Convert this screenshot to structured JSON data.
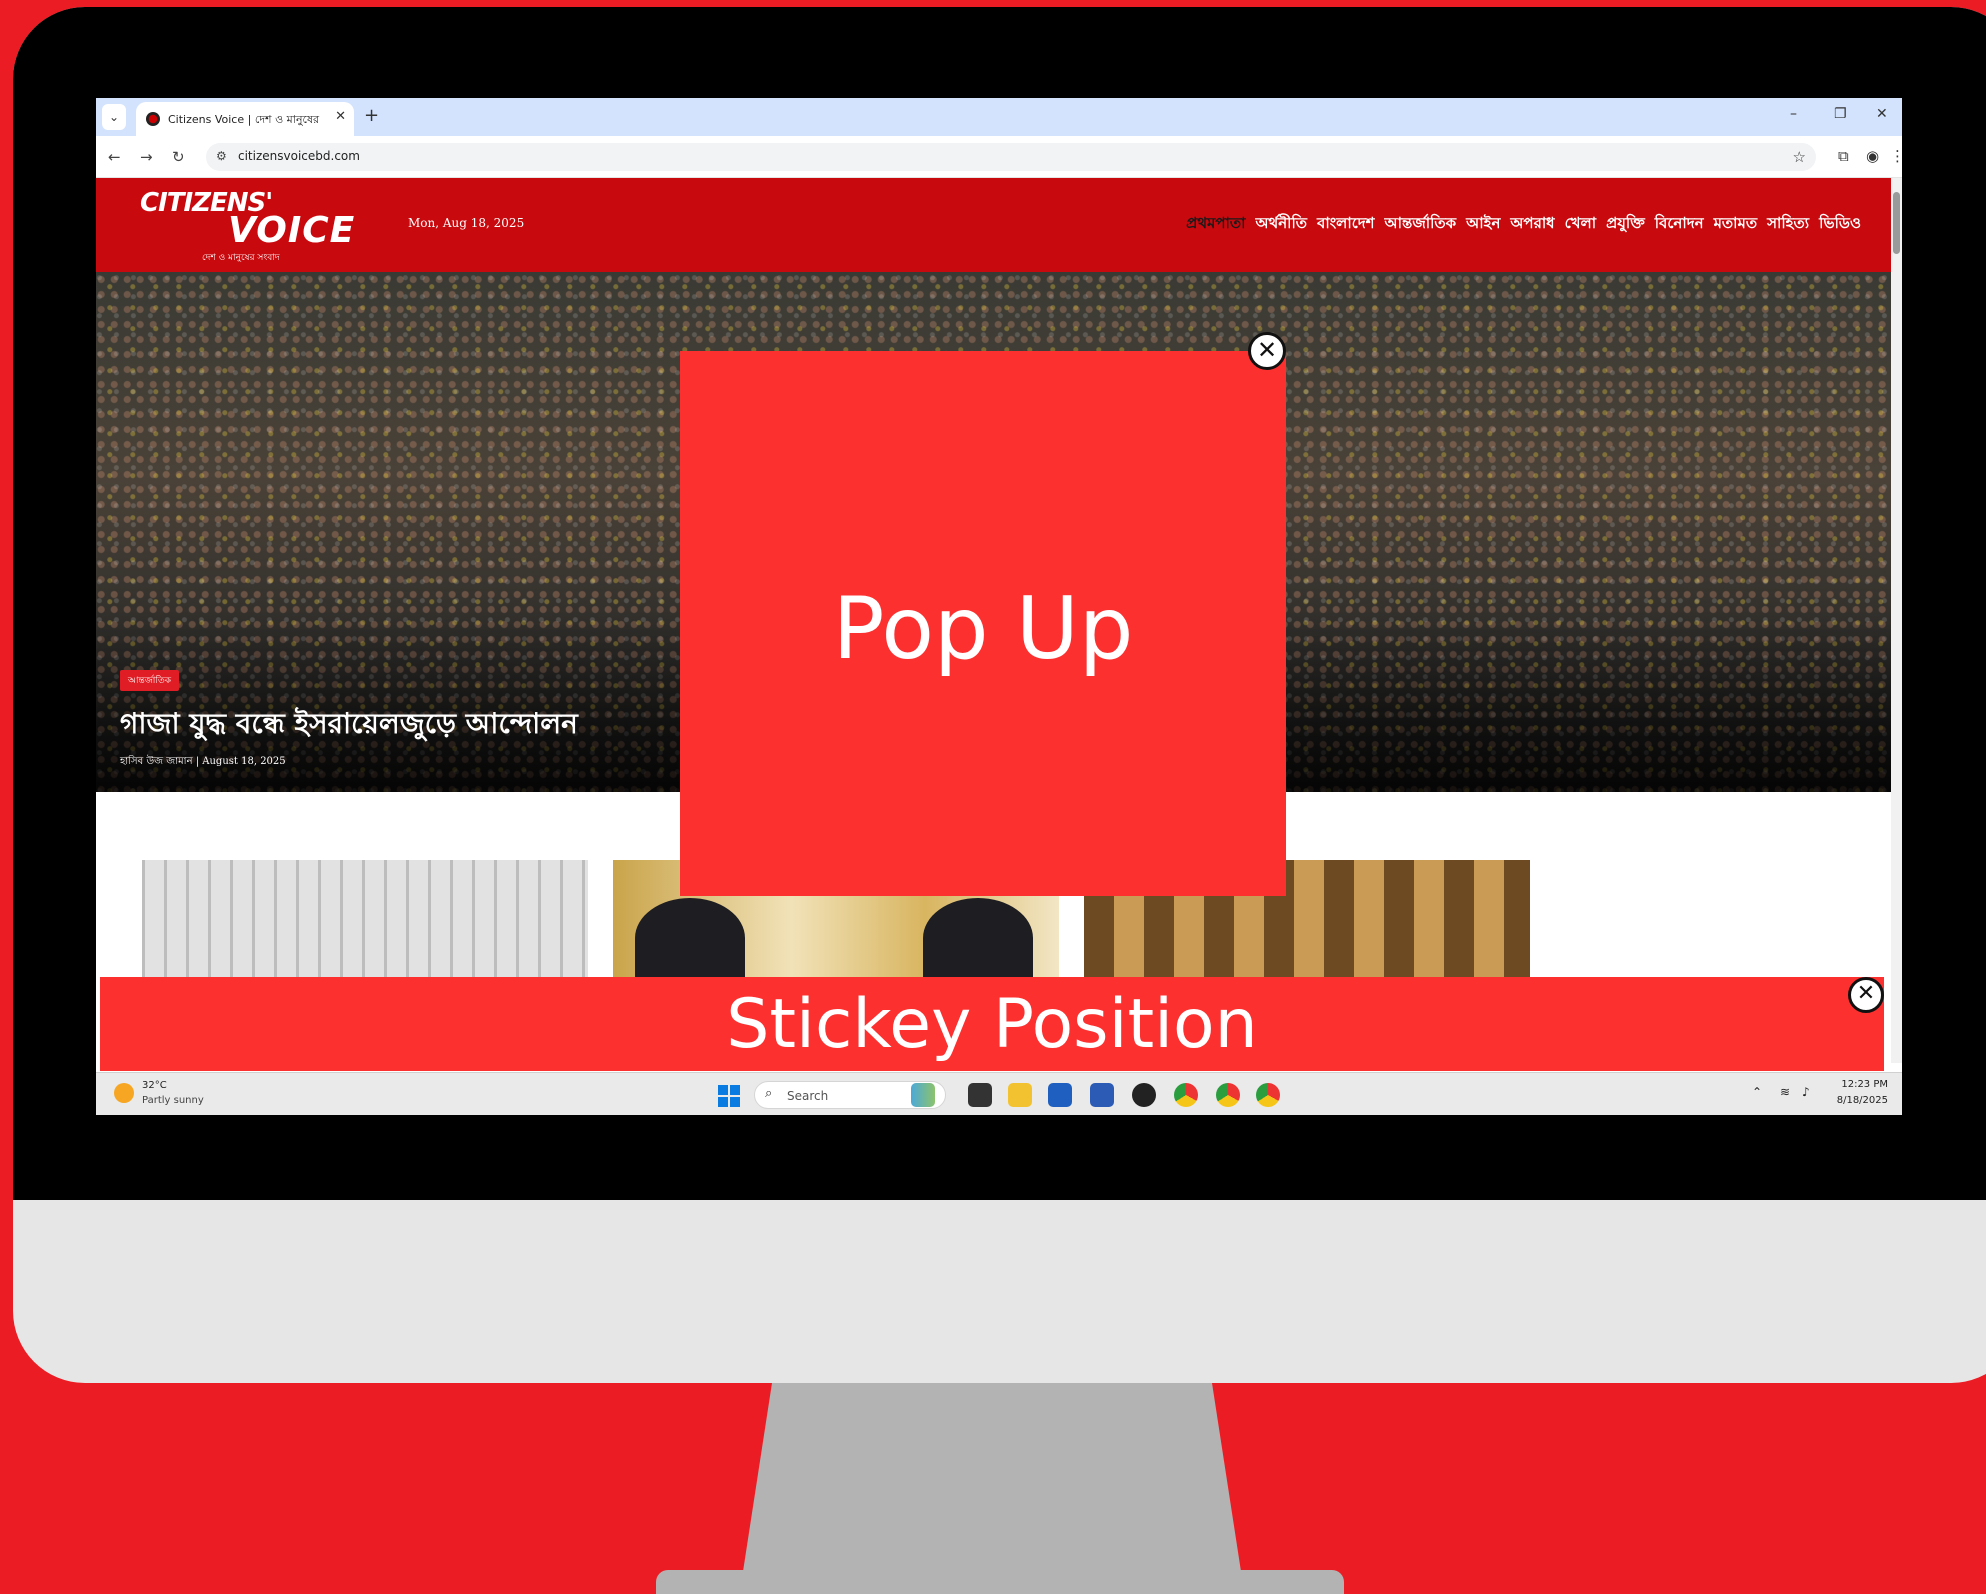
{
  "colors": {
    "background": "#ec1c24",
    "site_header": "#c8090e",
    "popup": "#fd3030",
    "bezel": "#000000",
    "monitor_body": "#e6e6e6",
    "stand": "#b3b3b3"
  },
  "browser": {
    "tab_title": "Citizens Voice | দেশ ও মানুষের সংবাদ",
    "tab_close": "✕",
    "new_tab": "+",
    "minimize": "–",
    "restore": "❐",
    "close": "✕",
    "back": "←",
    "forward": "→",
    "reload": "↻",
    "url": "citizensvoicebd.com",
    "bookmark_icon": "☆"
  },
  "site": {
    "logo_top": "CITIZENS'",
    "logo_main": "VOICE",
    "logo_tagline": "দেশ ও মানুষের সংবাদ",
    "date": "Mon, Aug 18, 2025",
    "nav": [
      "প্রথমপাতা",
      "অর্থনীতি",
      "বাংলাদেশ",
      "আন্তর্জাতিক",
      "আইন",
      "অপরাধ",
      "খেলা",
      "প্রযুক্তি",
      "বিনোদন",
      "মতামত",
      "সাহিত্য",
      "ভিডিও"
    ]
  },
  "hero": {
    "category": "আন্তর্জাতিক",
    "headline": "গাজা যুদ্ধ বন্ধে ইসরায়েলজুড়ে আন্দোলন",
    "meta": "হাসিব উজ জামান  |  August 18, 2025"
  },
  "popup": {
    "text": "Pop Up",
    "close_icon": "✕"
  },
  "sticky": {
    "text": "Stickey Position",
    "close_icon": "✕"
  },
  "taskbar": {
    "temperature": "32°C",
    "weather": "Partly sunny",
    "search_placeholder": "Search",
    "search_icon": "⌕",
    "time": "12:23 PM",
    "date": "8/18/2025"
  }
}
